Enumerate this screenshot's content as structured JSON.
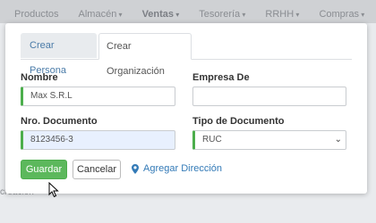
{
  "topnav": {
    "items": [
      "Productos",
      "Almacén",
      "Ventas",
      "Tesorería",
      "RRHH",
      "Compras"
    ],
    "active": "Ventas"
  },
  "background": {
    "bottom_text": "creación"
  },
  "modal": {
    "tabs": [
      "Crear Persona",
      "Crear Organización"
    ],
    "active_tab": "Crear Organización",
    "fields": {
      "nombre": {
        "label": "Nombre",
        "value": "Max S.R.L"
      },
      "empresa_de": {
        "label": "Empresa De",
        "value": ""
      },
      "nro_documento": {
        "label": "Nro. Documento",
        "value": "8123456-3"
      },
      "tipo_documento": {
        "label": "Tipo de Documento",
        "value": "RUC"
      }
    },
    "buttons": {
      "save": "Guardar",
      "cancel": "Cancelar",
      "add_address": "Agregar Dirección"
    }
  },
  "colors": {
    "accent_green": "#5cb85c",
    "link_blue": "#337ab7",
    "tab_active_blue": "#4a7ba8"
  }
}
